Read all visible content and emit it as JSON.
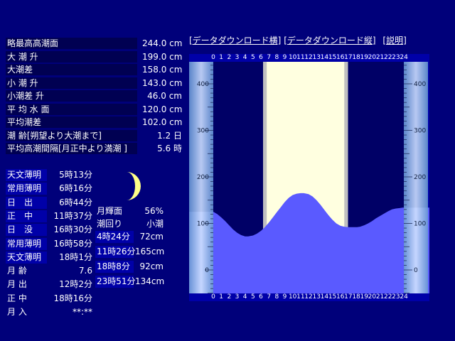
{
  "tide_info": [
    {
      "label": "略最高高潮面",
      "value": "244.0 cm"
    },
    {
      "label": "大 潮 升",
      "value": "199.0 cm"
    },
    {
      "label": "大潮差",
      "value": "158.0 cm"
    },
    {
      "label": "小 潮 升",
      "value": "143.0 cm"
    },
    {
      "label": "小潮差 升",
      "value": "46.0 cm"
    },
    {
      "label": "平 均 水 面",
      "value": "120.0 cm"
    },
    {
      "label": "平均潮差",
      "value": "102.0 cm"
    },
    {
      "label": "潮 齢[朔望より大潮まで]",
      "value": "1.2 日"
    },
    {
      "label": "平均高潮間隔[月正中より満潮 ]",
      "value": "5.6 時"
    }
  ],
  "sun_moon": [
    {
      "label": "天文薄明",
      "value": "5時13分"
    },
    {
      "label": "常用薄明",
      "value": "6時16分"
    },
    {
      "label": "日　出",
      "value": "6時44分"
    },
    {
      "label": "正　中",
      "value": "11時37分"
    },
    {
      "label": "日　没",
      "value": "16時30分"
    },
    {
      "label": "常用薄明",
      "value": "16時58分"
    },
    {
      "label": "天文薄明",
      "value": "18時1分"
    },
    {
      "label": "月 齢",
      "value": "7.6"
    },
    {
      "label": "月 出",
      "value": "12時2分"
    },
    {
      "label": "正 中",
      "value": "18時16分"
    },
    {
      "label": "月 入",
      "value": "**:**"
    }
  ],
  "moon_panel": {
    "illumination_label": "月輝面",
    "illumination_value": "56%",
    "tide_type_label": "潮回り",
    "tide_type_value": "小潮",
    "tides": [
      {
        "time": "4時24分",
        "height": "72cm"
      },
      {
        "time": "11時26分",
        "height": "165cm"
      },
      {
        "time": "18時8分",
        "height": "92cm"
      },
      {
        "time": "23時51分",
        "height": "134cm"
      }
    ]
  },
  "links": {
    "horizontal": "[データダウンロード横]",
    "vertical": "[データダウンロード縦]",
    "help": "[説明]"
  },
  "hours": [
    "0",
    "1",
    "2",
    "3",
    "4",
    "5",
    "6",
    "7",
    "8",
    "9",
    "10",
    "11",
    "12",
    "13",
    "14",
    "15",
    "16",
    "17",
    "18",
    "19",
    "20",
    "21",
    "22",
    "23",
    "24"
  ],
  "colors": {
    "background": "#00007a",
    "plot_bg": "#0000a8",
    "night": "#000066",
    "daylight": "#ffffe0",
    "twilight": "#c0c0c0",
    "water": "#5a5aff",
    "ruler": "#b0d4f0"
  },
  "chart_data": {
    "type": "area",
    "x": [
      0,
      0.5,
      1,
      1.5,
      2,
      2.5,
      3,
      3.5,
      4,
      4.4,
      5,
      5.5,
      6,
      6.5,
      7,
      7.5,
      8,
      8.5,
      9,
      9.5,
      10,
      10.5,
      11,
      11.4,
      12,
      12.5,
      13,
      13.5,
      14,
      14.5,
      15,
      15.5,
      16,
      16.5,
      17,
      17.5,
      18,
      18.1,
      18.5,
      19,
      19.5,
      20,
      20.5,
      21,
      21.5,
      22,
      22.5,
      23,
      23.5,
      23.85,
      24
    ],
    "y": [
      125,
      120,
      113,
      105,
      96,
      87,
      80,
      75,
      72,
      72,
      74,
      78,
      84,
      92,
      102,
      113,
      124,
      135,
      146,
      155,
      161,
      164,
      165,
      165,
      163,
      158,
      150,
      140,
      129,
      118,
      108,
      100,
      95,
      93,
      92,
      92,
      92,
      92,
      93,
      96,
      100,
      105,
      111,
      116,
      121,
      126,
      130,
      132,
      133,
      134,
      134
    ],
    "ylim": [
      -50,
      450
    ],
    "yticks": [
      0,
      100,
      200,
      300,
      400
    ],
    "xlim": [
      0,
      24
    ],
    "daylight": [
      6.73,
      16.5
    ],
    "civil_twilight": [
      6.27,
      16.97
    ]
  }
}
